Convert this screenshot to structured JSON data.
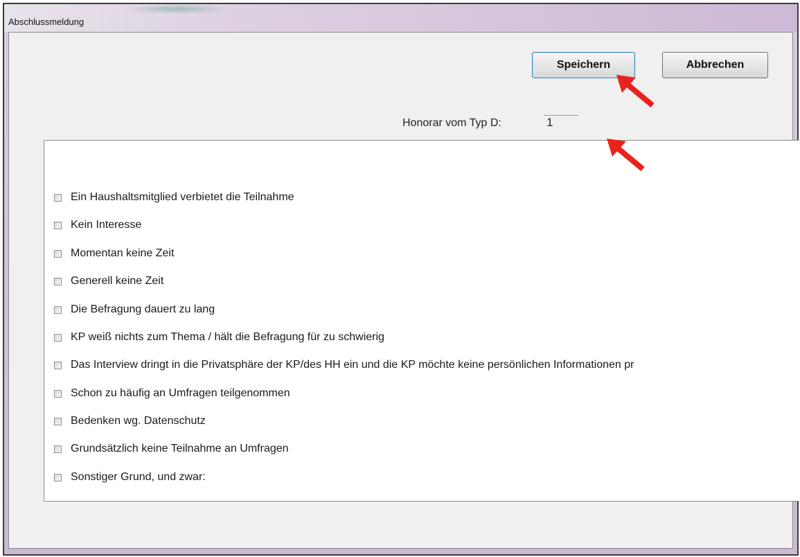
{
  "window": {
    "title": "Abschlussmeldung"
  },
  "toolbar": {
    "save_label": "Speichern",
    "cancel_label": "Abbrechen"
  },
  "honorar": {
    "label": "Honorar vom Typ D:",
    "value": "1"
  },
  "reasons": [
    "Ein Haushaltsmitglied verbietet die Teilnahme",
    "Kein Interesse",
    "Momentan keine Zeit",
    "Generell keine Zeit",
    "Die Befragung dauert zu lang",
    "KP weiß nichts zum Thema / hält die  Befragung für zu schwierig",
    "Das Interview dringt in die Privatsphäre der KP/des HH ein und die KP möchte keine persönlichen Informationen pr",
    "Schon zu häufig an Umfragen teilgenommen",
    "Bedenken wg. Datenschutz",
    "Grundsätzlich keine Teilnahme an Umfragen",
    "Sonstiger Grund, und zwar:"
  ],
  "colors": {
    "annotation_arrow": "#e8231c",
    "save_border": "#3c7fb1"
  }
}
